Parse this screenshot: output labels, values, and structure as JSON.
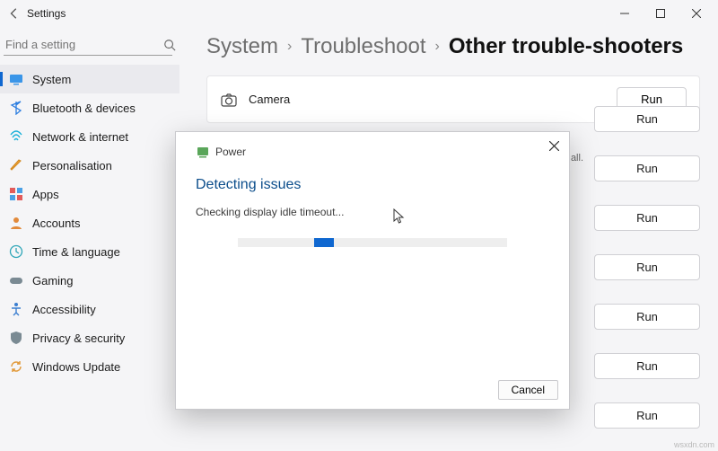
{
  "window": {
    "title": "Settings"
  },
  "search": {
    "placeholder": "Find a setting"
  },
  "sidebar": {
    "items": [
      {
        "label": "System"
      },
      {
        "label": "Bluetooth & devices"
      },
      {
        "label": "Network & internet"
      },
      {
        "label": "Personalisation"
      },
      {
        "label": "Apps"
      },
      {
        "label": "Accounts"
      },
      {
        "label": "Time & language"
      },
      {
        "label": "Gaming"
      },
      {
        "label": "Accessibility"
      },
      {
        "label": "Privacy & security"
      },
      {
        "label": "Windows Update"
      }
    ]
  },
  "breadcrumb": {
    "a": "System",
    "b": "Troubleshoot",
    "c": "Other trouble-shooters"
  },
  "card": {
    "camera": "Camera"
  },
  "run_label": "Run",
  "video_note": "all.",
  "dialog": {
    "name": "Power",
    "heading": "Detecting issues",
    "status": "Checking display idle timeout...",
    "cancel": "Cancel"
  },
  "watermark": "wsxdn.com"
}
